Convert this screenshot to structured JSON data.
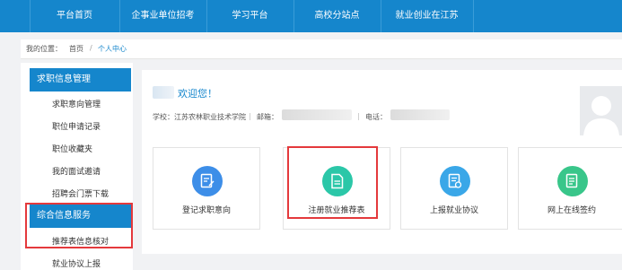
{
  "nav": {
    "items": [
      "平台首页",
      "企事业单位招考",
      "学习平台",
      "高校分站点",
      "就业创业在江苏"
    ]
  },
  "breadcrumb": {
    "prefix": "我的位置：",
    "home": "首页",
    "sep": "/",
    "current": "个人中心"
  },
  "sidebar": {
    "group1_title": "求职信息管理",
    "group1_items": [
      "求职意向管理",
      "职位申请记录",
      "职位收藏夹",
      "我的面试邀请",
      "招聘会门票下载"
    ],
    "group2_title": "综合信息服务",
    "group2_items": [
      "推荐表信息核对",
      "就业协议上报"
    ]
  },
  "profile": {
    "welcome": "欢迎您！",
    "school_label": "学校：",
    "school": "江苏农林职业技术学院",
    "email_label": "邮箱：",
    "phone_label": "电话："
  },
  "cards": [
    {
      "label": "登记求职意向",
      "icon": "edit-doc-icon",
      "color": "#3d8ee8"
    },
    {
      "label": "注册就业推荐表",
      "icon": "document-icon",
      "color": "#2bc7a8"
    },
    {
      "label": "上报就业协议",
      "icon": "contract-icon",
      "color": "#3aa7e8"
    },
    {
      "label": "网上在线签约",
      "icon": "sign-icon",
      "color": "#39c68a"
    }
  ],
  "colors": {
    "primary": "#1586cc",
    "highlight": "#e4393c"
  }
}
